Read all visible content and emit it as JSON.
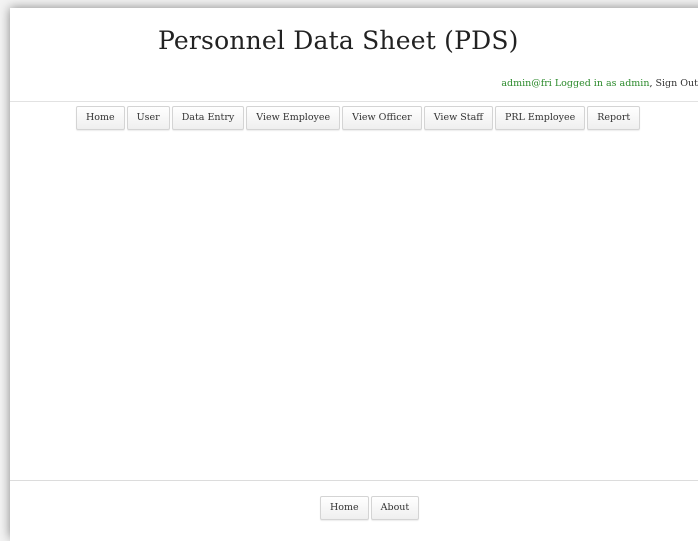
{
  "header": {
    "title": "Personnel Data Sheet (PDS)",
    "login": {
      "user": "admin@fri",
      "status": "Logged in as admin",
      "separator": ",",
      "signout": "Sign Out"
    }
  },
  "nav": {
    "items": [
      {
        "label": "Home"
      },
      {
        "label": "User"
      },
      {
        "label": "Data Entry"
      },
      {
        "label": "View Employee"
      },
      {
        "label": "View Officer"
      },
      {
        "label": "View Staff"
      },
      {
        "label": "PRL Employee"
      },
      {
        "label": "Report"
      }
    ]
  },
  "footer": {
    "items": [
      {
        "label": "Home"
      },
      {
        "label": "About"
      }
    ]
  },
  "colors": {
    "accent_green": "#2b8a2b"
  }
}
